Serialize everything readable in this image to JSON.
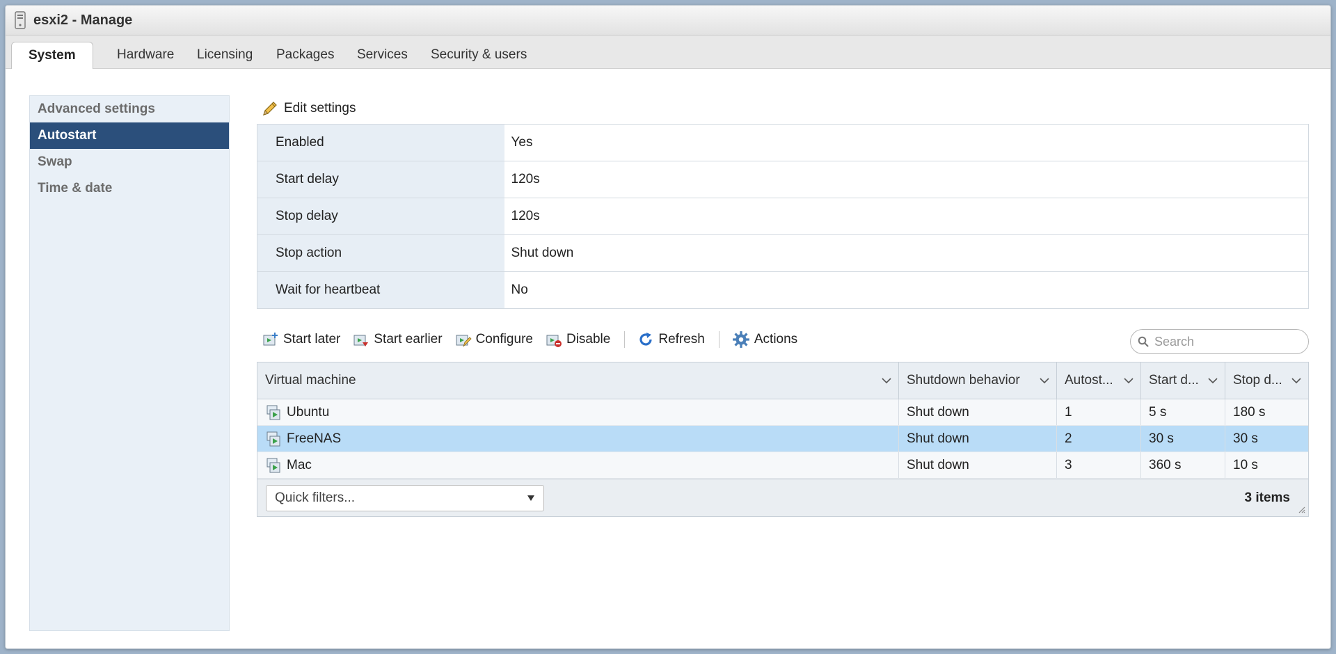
{
  "window": {
    "title": "esxi2 - Manage"
  },
  "tabs": [
    "System",
    "Hardware",
    "Licensing",
    "Packages",
    "Services",
    "Security & users"
  ],
  "sidebar": {
    "items": [
      "Advanced settings",
      "Autostart",
      "Swap",
      "Time & date"
    ]
  },
  "edit_settings": "Edit settings",
  "settings": [
    {
      "key": "Enabled",
      "value": "Yes"
    },
    {
      "key": "Start delay",
      "value": "120s"
    },
    {
      "key": "Stop delay",
      "value": "120s"
    },
    {
      "key": "Stop action",
      "value": "Shut down"
    },
    {
      "key": "Wait for heartbeat",
      "value": "No"
    }
  ],
  "toolbar": {
    "start_later": "Start later",
    "start_earlier": "Start earlier",
    "configure": "Configure",
    "disable": "Disable",
    "refresh": "Refresh",
    "actions": "Actions"
  },
  "search": {
    "placeholder": "Search"
  },
  "grid": {
    "columns": [
      "Virtual machine",
      "Shutdown behavior",
      "Autost...",
      "Start d...",
      "Stop d..."
    ],
    "rows": [
      {
        "vm": "Ubuntu",
        "shutdown": "Shut down",
        "autostart": "1",
        "start_delay": "5 s",
        "stop_delay": "180 s"
      },
      {
        "vm": "FreeNAS",
        "shutdown": "Shut down",
        "autostart": "2",
        "start_delay": "30 s",
        "stop_delay": "30 s"
      },
      {
        "vm": "Mac",
        "shutdown": "Shut down",
        "autostart": "3",
        "start_delay": "360 s",
        "stop_delay": "10 s"
      }
    ],
    "quick_filters": "Quick filters...",
    "count": "3 items"
  },
  "colors": {
    "selected_sidebar": "#2b4f7b",
    "selected_row": "#b9dcf7",
    "refresh_icon": "#2a6fc9"
  }
}
